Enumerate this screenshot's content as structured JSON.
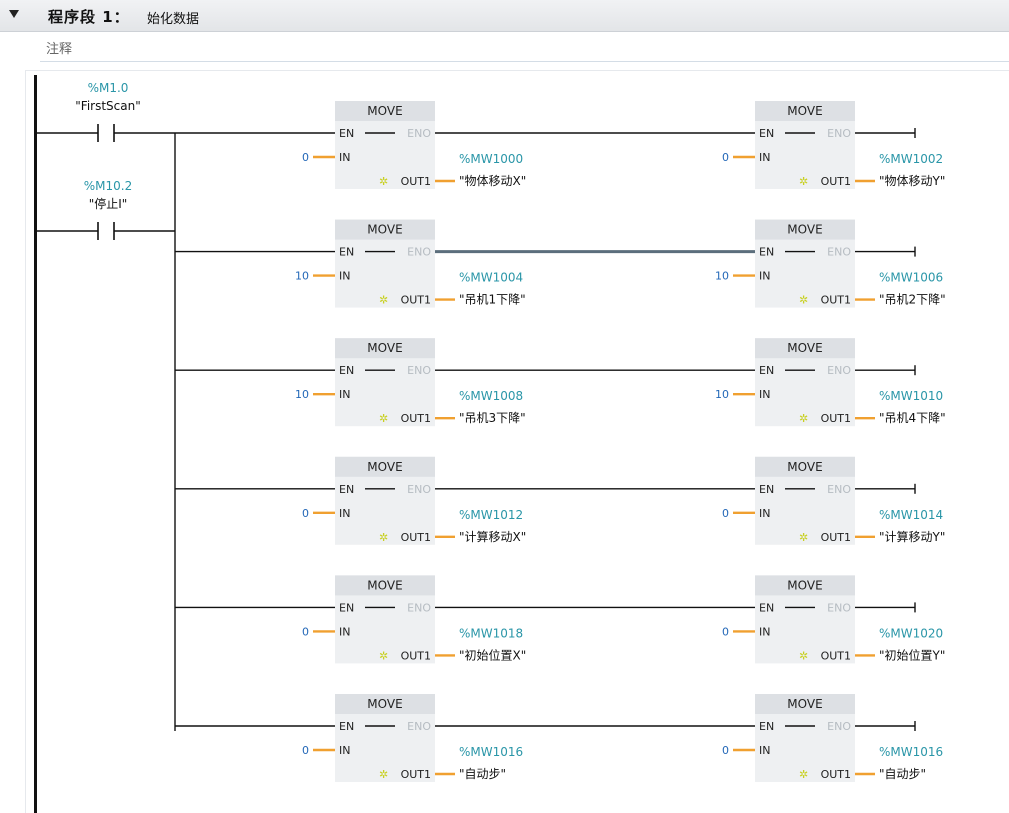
{
  "network": {
    "title": "程序段 1：",
    "name": "始化数据",
    "comment": "注释"
  },
  "contacts": [
    {
      "address": "%M1.0",
      "symbol": "\"FirstScan\""
    },
    {
      "address": "%M10.2",
      "symbol": "\"停止I\""
    }
  ],
  "move_rows": [
    {
      "left": {
        "title": "MOVE",
        "en": "EN",
        "eno": "ENO",
        "in_label": "IN",
        "out_label": "OUT1",
        "in_value": "0",
        "out_address": "%MW1000",
        "out_symbol": "\"物体移动X\""
      },
      "right": {
        "title": "MOVE",
        "en": "EN",
        "eno": "ENO",
        "in_label": "IN",
        "out_label": "OUT1",
        "in_value": "0",
        "out_address": "%MW1002",
        "out_symbol": "\"物体移动Y\""
      }
    },
    {
      "left": {
        "title": "MOVE",
        "en": "EN",
        "eno": "ENO",
        "in_label": "IN",
        "out_label": "OUT1",
        "in_value": "10",
        "out_address": "%MW1004",
        "out_symbol": "\"吊机1下降\""
      },
      "right": {
        "title": "MOVE",
        "en": "EN",
        "eno": "ENO",
        "in_label": "IN",
        "out_label": "OUT1",
        "in_value": "10",
        "out_address": "%MW1006",
        "out_symbol": "\"吊机2下降\""
      }
    },
    {
      "left": {
        "title": "MOVE",
        "en": "EN",
        "eno": "ENO",
        "in_label": "IN",
        "out_label": "OUT1",
        "in_value": "10",
        "out_address": "%MW1008",
        "out_symbol": "\"吊机3下降\""
      },
      "right": {
        "title": "MOVE",
        "en": "EN",
        "eno": "ENO",
        "in_label": "IN",
        "out_label": "OUT1",
        "in_value": "10",
        "out_address": "%MW1010",
        "out_symbol": "\"吊机4下降\""
      }
    },
    {
      "left": {
        "title": "MOVE",
        "en": "EN",
        "eno": "ENO",
        "in_label": "IN",
        "out_label": "OUT1",
        "in_value": "0",
        "out_address": "%MW1012",
        "out_symbol": "\"计算移动X\""
      },
      "right": {
        "title": "MOVE",
        "en": "EN",
        "eno": "ENO",
        "in_label": "IN",
        "out_label": "OUT1",
        "in_value": "0",
        "out_address": "%MW1014",
        "out_symbol": "\"计算移动Y\""
      }
    },
    {
      "left": {
        "title": "MOVE",
        "en": "EN",
        "eno": "ENO",
        "in_label": "IN",
        "out_label": "OUT1",
        "in_value": "0",
        "out_address": "%MW1018",
        "out_symbol": "\"初始位置X\""
      },
      "right": {
        "title": "MOVE",
        "en": "EN",
        "eno": "ENO",
        "in_label": "IN",
        "out_label": "OUT1",
        "in_value": "0",
        "out_address": "%MW1020",
        "out_symbol": "\"初始位置Y\""
      }
    },
    {
      "left": {
        "title": "MOVE",
        "en": "EN",
        "eno": "ENO",
        "in_label": "IN",
        "out_label": "OUT1",
        "in_value": "0",
        "out_address": "%MW1016",
        "out_symbol": "\"自动步\""
      },
      "right": {
        "title": "MOVE",
        "en": "EN",
        "eno": "ENO",
        "in_label": "IN",
        "out_label": "OUT1",
        "in_value": "0",
        "out_address": "%MW1016",
        "out_symbol": "\"自动步\""
      }
    }
  ],
  "selected_wire_row": 1,
  "icons": {
    "collapse": "triangle-down-icon",
    "generate": "sparkle-icon"
  },
  "colors": {
    "address": "#2a96a8",
    "constant": "#2468b8",
    "pin": "#f0a030",
    "box": "#eef0f2"
  }
}
